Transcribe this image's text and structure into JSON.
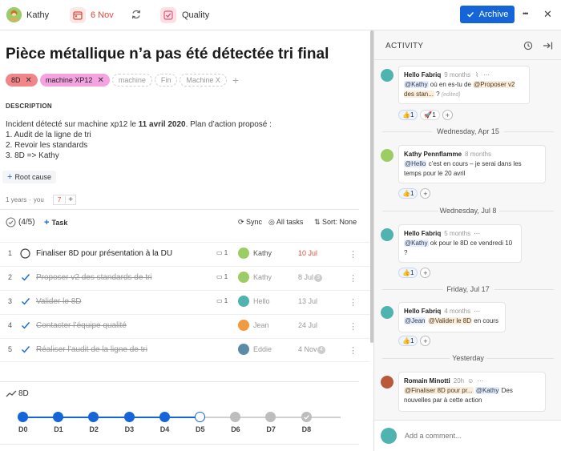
{
  "topbar": {
    "user_name": "Kathy",
    "date": "6 Nov",
    "quality_label": "Quality",
    "archive_label": "Archive",
    "more": "•••",
    "close": "✕"
  },
  "title": "Pièce métallique n’a pas été détectée tri final",
  "tags": {
    "active": [
      {
        "label": "8D",
        "color": "#f2858a"
      },
      {
        "label": "machine XP12",
        "color": "#f5a3e0"
      }
    ],
    "suggested": [
      "machine",
      "Fin",
      "Machine X"
    ]
  },
  "description": {
    "heading": "DESCRIPTION",
    "line1_pre": "Incident détecté sur machine xp12 le ",
    "line1_bold": "11 avril 2020",
    "line1_post": ". Plan d’action proposé :",
    "items": [
      "Audit de la ligne de tri",
      "Revoir les standards",
      "8D => Kathy"
    ]
  },
  "root_cause_label": "Root cause",
  "meta": {
    "years": "1 years",
    "you": "you",
    "value": "7"
  },
  "tasks_header": {
    "count": "(4/5)",
    "add_task": "Task",
    "sync": "Sync",
    "all_tasks": "All tasks",
    "sort": "Sort: None"
  },
  "tasks": [
    {
      "num": "1",
      "title": "Finaliser 8D pour présentation à la DU",
      "comments": "1",
      "assignee": "Kathy",
      "date": "10 Jul",
      "badge": ""
    },
    {
      "num": "2",
      "title": "Proposer v2 des standards de tri",
      "comments": "1",
      "assignee": "Kathy",
      "date": "8 Jul",
      "badge": "3"
    },
    {
      "num": "3",
      "title": "Valider le 8D",
      "comments": "1",
      "assignee": "Hello",
      "date": "13 Jul",
      "badge": ""
    },
    {
      "num": "4",
      "title": "Contacter l’équipe qualité",
      "comments": "",
      "assignee": "Jean",
      "date": "24 Jul",
      "badge": ""
    },
    {
      "num": "5",
      "title": "Réaliser l’audit de la ligne de tri",
      "comments": "",
      "assignee": "Eddie",
      "date": "4 Nov",
      "badge": "4"
    }
  ],
  "workflow": {
    "label": "8D",
    "steps": [
      "D0",
      "D1",
      "D2",
      "D3",
      "D4",
      "D5",
      "D6",
      "D7",
      "D8"
    ],
    "current_step": "D5"
  },
  "activity": {
    "heading": "ACTIVITY",
    "add_comment_placeholder": "Add a comment...",
    "day_separators": [
      "Wednesday, Apr 15",
      "Wednesday, Jul 8",
      "Friday, Jul 17",
      "Yesterday"
    ],
    "comments": [
      {
        "author": "Hello Fabriq",
        "time": "9 months",
        "m1": "@Kathy",
        "t1": " où en es-tu de ",
        "m2": "@Proposer v2 des stan...",
        "t2": " ?",
        "edited": "(edited)",
        "r1": "1",
        "r2": "1"
      },
      {
        "author": "Kathy Pennflamme",
        "time": "8 months",
        "m1": "@Hello",
        "t1": " c’est en cours – je serai dans les temps pour le 20 avril",
        "r1": "1"
      },
      {
        "author": "Hello Fabriq",
        "time": "5 months",
        "m1": "@Kathy",
        "t1": " ok pour le 8D ce vendredi 10 ?",
        "r1": "1"
      },
      {
        "author": "Hello Fabriq",
        "time": "4 months",
        "m1": "@Jean",
        "m2": "@Valider le 8D",
        "t2": " en cours",
        "r1": "1"
      },
      {
        "author": "Romain Minotti",
        "time": "20h",
        "m1": "@Finaliser 8D pour pr...",
        "m2": "@Kathy",
        "t2": " Des nouvelles par à cette action"
      }
    ]
  },
  "colors": {
    "accent": "#1565d8",
    "date_red": "#e04b3c",
    "tag_8d": "#f2858a",
    "tag_machine": "#f5a3e0"
  }
}
